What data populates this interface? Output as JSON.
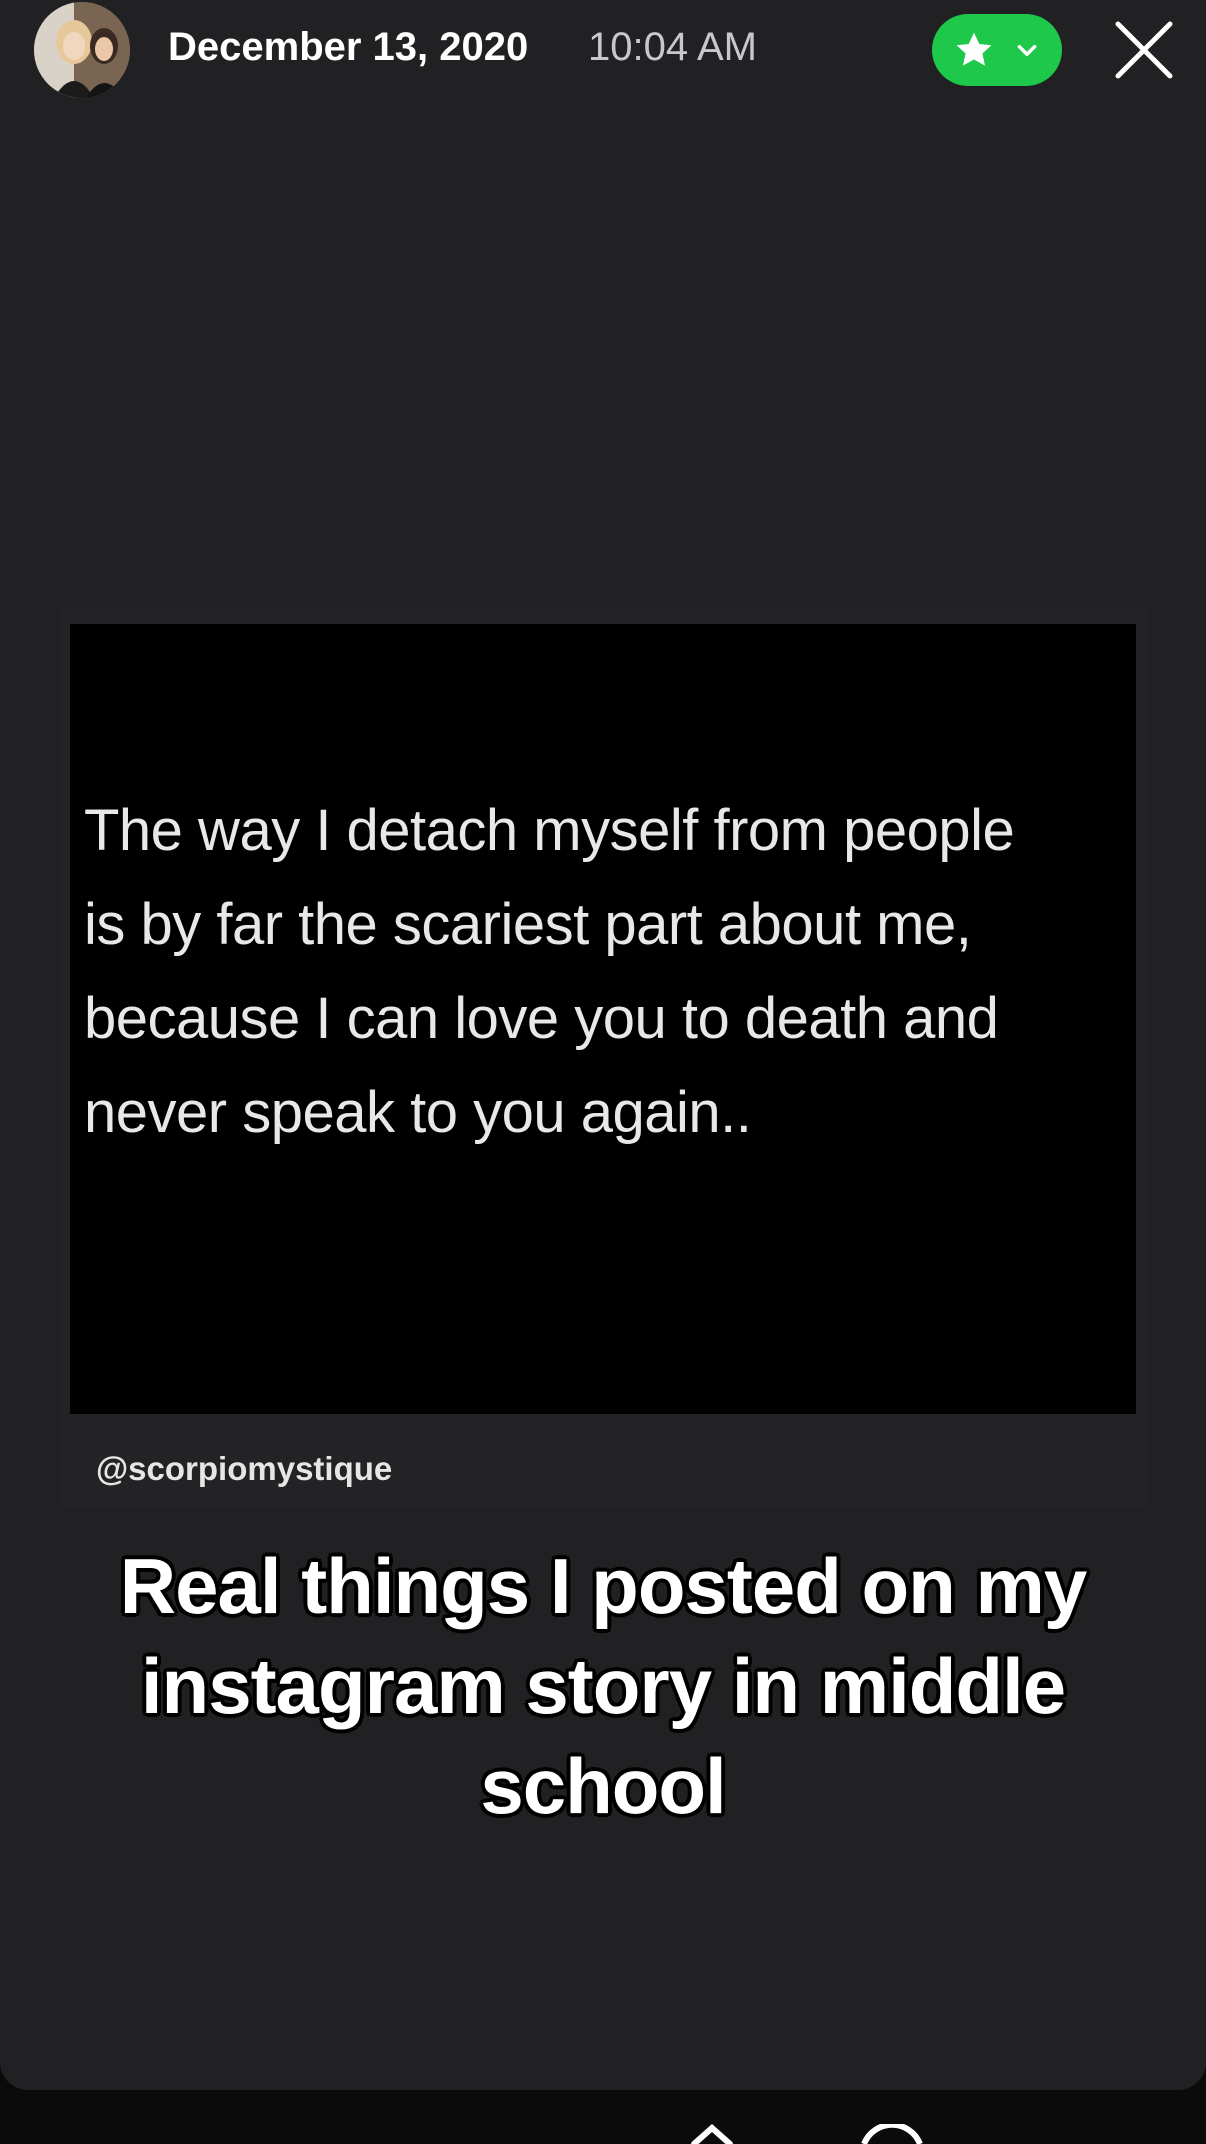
{
  "header": {
    "date": "December 13, 2020",
    "time": "10:04 AM",
    "favorite": {
      "icon": "star-icon",
      "dropdown_icon": "chevron-down-icon",
      "color": "#1ec84a"
    },
    "close_icon": "close-icon"
  },
  "story": {
    "quote_text": "The way I detach myself from people\nis by far the scariest part about me,\nbecause I can love you to death and\nnever speak to you again..",
    "handle": "@scorpiomystique",
    "caption": "Real things I posted on my instagram story in middle school"
  },
  "colors": {
    "background": "#212123",
    "accent": "#1ec84a"
  }
}
